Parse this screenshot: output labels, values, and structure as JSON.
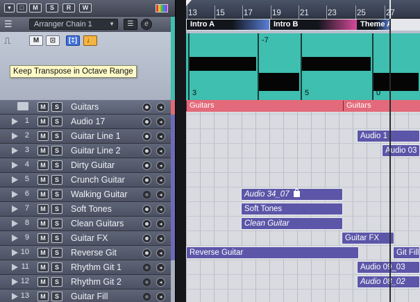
{
  "toolbar": {
    "buttons": [
      "▾",
      "□",
      "M",
      "S",
      "R",
      "W"
    ]
  },
  "arranger": {
    "chain_label": "Arranger Chain 1",
    "tooltip": "Keep Transpose in Octave Range",
    "buttons": {
      "mute": "M",
      "solo_lock": "",
      "keep_range": "[‡]",
      "note": "♩"
    }
  },
  "ruler": {
    "bars": [
      "13",
      "15",
      "17",
      "19",
      "21",
      "23",
      "25",
      "27"
    ]
  },
  "arranger_events": [
    {
      "label": "Intro A",
      "color": "#5a7fd6"
    },
    {
      "label": "Intro B",
      "color": "#d64a9a"
    },
    {
      "label": "Theme A",
      "color": "#5a7fd6"
    }
  ],
  "transpose": {
    "segments": [
      {
        "label": "3"
      },
      {
        "label": "-7"
      },
      {
        "label": "5"
      },
      {
        "label": "0"
      }
    ]
  },
  "tracks": [
    {
      "num": "",
      "name": "Guitars",
      "folder": true
    },
    {
      "num": "1",
      "name": "Audio 17"
    },
    {
      "num": "2",
      "name": "Guitar Line 1"
    },
    {
      "num": "3",
      "name": "Guitar Line 2"
    },
    {
      "num": "4",
      "name": "Dirty Guitar"
    },
    {
      "num": "5",
      "name": "Crunch Guitar"
    },
    {
      "num": "6",
      "name": "Walking Guitar"
    },
    {
      "num": "7",
      "name": "Soft Tones"
    },
    {
      "num": "8",
      "name": "Clean Guitars"
    },
    {
      "num": "9",
      "name": "Guitar FX"
    },
    {
      "num": "10",
      "name": "Reverse Git"
    },
    {
      "num": "11",
      "name": "Rhythm Git 1"
    },
    {
      "num": "12",
      "name": "Rhythm Git 2"
    },
    {
      "num": "13",
      "name": "Guitar Fill"
    }
  ],
  "folder_parts": [
    "Guitars",
    "Guitars"
  ],
  "events": [
    {
      "label": "Audio 1"
    },
    {
      "label": "Audio 03"
    },
    {
      "label": "Audio 34_07"
    },
    {
      "label": "Soft Tones"
    },
    {
      "label": "Clean Guitar"
    },
    {
      "label": "Guitar FX"
    },
    {
      "label": "Reverse Guitar"
    },
    {
      "label": "Git Fill"
    },
    {
      "label": "Audio 09_03"
    },
    {
      "label": "Audio 08_02"
    }
  ],
  "ms_labels": {
    "mute": "M",
    "solo": "S"
  }
}
